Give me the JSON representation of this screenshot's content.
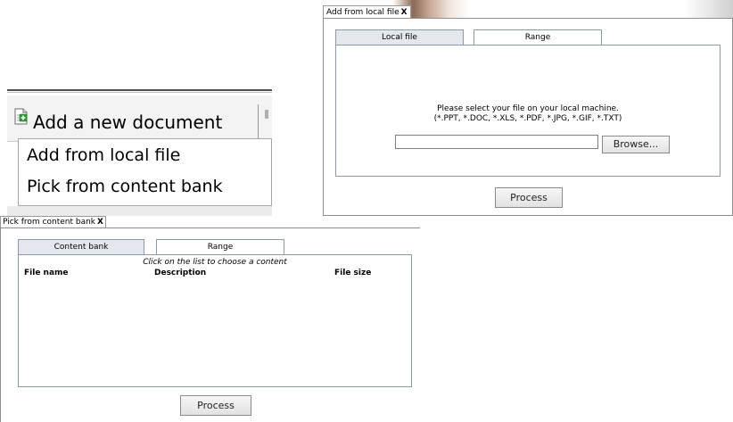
{
  "local_file_dialog": {
    "title": "Add from local file",
    "close": "X",
    "tabs": [
      {
        "label": "Local file",
        "active": true
      },
      {
        "label": "Range",
        "active": false
      }
    ],
    "message_line1": "Please select your file on your local machine.",
    "message_line2": "(*.PPT, *.DOC, *.XLS, *.PDF, *.JPG, *.GIF, *.TXT)",
    "file_input_value": "",
    "browse_label": "Browse...",
    "process_label": "Process"
  },
  "document_menu": {
    "header_label": "Add a new document",
    "header_icon": "add-document-icon",
    "items": [
      {
        "label": "Add from local file"
      },
      {
        "label": "Pick from content bank"
      }
    ]
  },
  "content_bank_dialog": {
    "title": "Pick from content bank",
    "close": "X",
    "tabs": [
      {
        "label": "Content bank",
        "active": true
      },
      {
        "label": "Range",
        "active": false
      }
    ],
    "hint": "Click on the list to choose a content",
    "columns": [
      "File name",
      "Description",
      "File size"
    ],
    "rows": [],
    "process_label": "Process"
  },
  "colors": {
    "tab_border": "#8c9aa8",
    "tab_active_bg": "#e4e8ee",
    "icon_green": "#2e9e2e"
  }
}
